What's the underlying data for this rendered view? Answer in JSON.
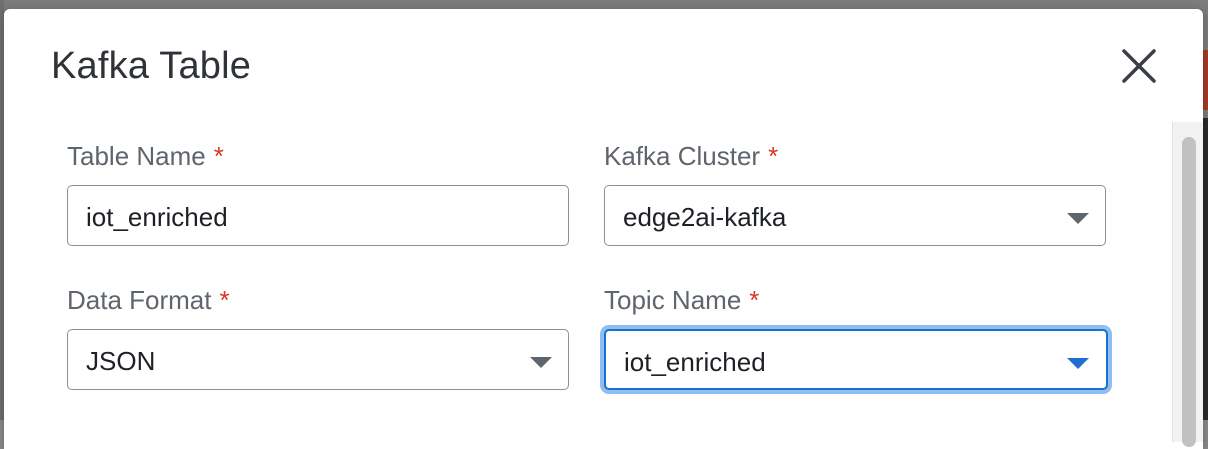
{
  "dialog": {
    "title": "Kafka Table",
    "close_icon": "close-icon"
  },
  "form": {
    "table_name": {
      "label": "Table Name",
      "required_mark": "*",
      "value": "iot_enriched"
    },
    "kafka_cluster": {
      "label": "Kafka Cluster",
      "required_mark": "*",
      "value": "edge2ai-kafka"
    },
    "data_format": {
      "label": "Data Format",
      "required_mark": "*",
      "value": "JSON"
    },
    "topic_name": {
      "label": "Topic Name",
      "required_mark": "*",
      "value": "iot_enriched"
    }
  },
  "colors": {
    "required": "#d9362b",
    "focus_border": "#1e6fd0",
    "focus_ring": "#8fbff0",
    "label": "#5f656c",
    "text": "#1d2126"
  }
}
